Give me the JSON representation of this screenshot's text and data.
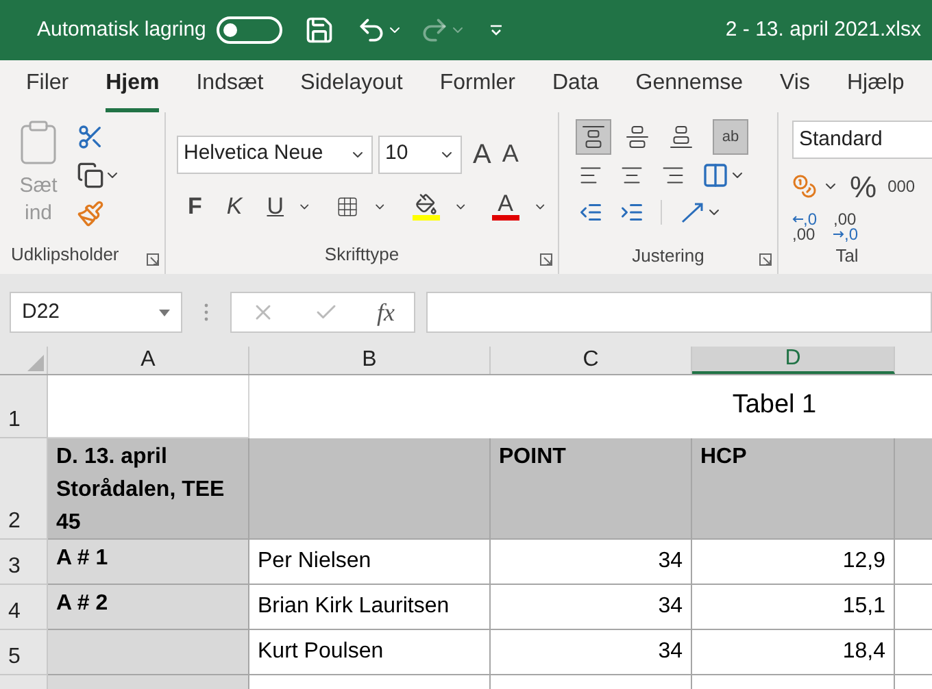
{
  "title_bar": {
    "autosave_label": "Automatisk lagring",
    "autosave": {
      "on": false
    },
    "file_name": "2 - 13. april 2021.xlsx"
  },
  "tabs": [
    {
      "label": "Filer",
      "selected": false
    },
    {
      "label": "Hjem",
      "selected": true
    },
    {
      "label": "Indsæt",
      "selected": false
    },
    {
      "label": "Sidelayout",
      "selected": false
    },
    {
      "label": "Formler",
      "selected": false
    },
    {
      "label": "Data",
      "selected": false
    },
    {
      "label": "Gennemse",
      "selected": false
    },
    {
      "label": "Vis",
      "selected": false
    },
    {
      "label": "Hjælp",
      "selected": false
    }
  ],
  "ribbon": {
    "clipboard": {
      "paste_label": "Sæt ind",
      "group_label": "Udklipsholder"
    },
    "font": {
      "family": "Helvetica Neue",
      "size": "10",
      "grow_label": "A",
      "shrink_label": "A",
      "bold_label": "F",
      "italic_label": "K",
      "underline_label": "U",
      "color_label": "A",
      "group_label": "Skrifttype"
    },
    "alignment": {
      "buttons": [
        {
          "kind": "align-top",
          "selected": true
        },
        {
          "kind": "align-middle",
          "selected": false
        },
        {
          "kind": "align-bottom",
          "selected": false
        },
        {
          "kind": "wrap-text",
          "selected": true
        }
      ],
      "wrap_label": "ab",
      "group_label": "Justering"
    },
    "number": {
      "format": "Standard",
      "percent_label": "%",
      "thousands_label": "000",
      "increase_decimal": [
        ",0",
        ",00"
      ],
      "decrease_decimal": [
        ",00",
        ",0"
      ],
      "group_label": "Tal"
    }
  },
  "formula_bar": {
    "name_box": "D22",
    "fx_label": "fx"
  },
  "sheet": {
    "columns": [
      {
        "label": "A",
        "selected": false
      },
      {
        "label": "B",
        "selected": false
      },
      {
        "label": "C",
        "selected": false
      },
      {
        "label": "D",
        "selected": true
      }
    ],
    "rows": [
      {
        "number": "1",
        "title": "Tabel 1"
      },
      {
        "number": "2",
        "cells": [
          {
            "kind": "header",
            "text": "D. 13. april Storådalen, TEE 45"
          },
          {
            "kind": "header",
            "text": ""
          },
          {
            "kind": "header",
            "text": "POINT"
          },
          {
            "kind": "header",
            "text": "HCP"
          }
        ]
      },
      {
        "number": "3",
        "cells": [
          {
            "kind": "label",
            "text": "A # 1"
          },
          {
            "kind": "text",
            "text": "Per Nielsen"
          },
          {
            "kind": "number",
            "text": "34"
          },
          {
            "kind": "number",
            "text": "12,9"
          }
        ]
      },
      {
        "number": "4",
        "cells": [
          {
            "kind": "label",
            "text": "A # 2"
          },
          {
            "kind": "text",
            "text": "Brian Kirk Lauritsen"
          },
          {
            "kind": "number",
            "text": "34"
          },
          {
            "kind": "number",
            "text": "15,1"
          }
        ]
      },
      {
        "number": "5",
        "cells": [
          {
            "kind": "label",
            "text": ""
          },
          {
            "kind": "text",
            "text": "Kurt Poulsen"
          },
          {
            "kind": "number",
            "text": "34"
          },
          {
            "kind": "number",
            "text": "18,4"
          }
        ]
      }
    ]
  }
}
